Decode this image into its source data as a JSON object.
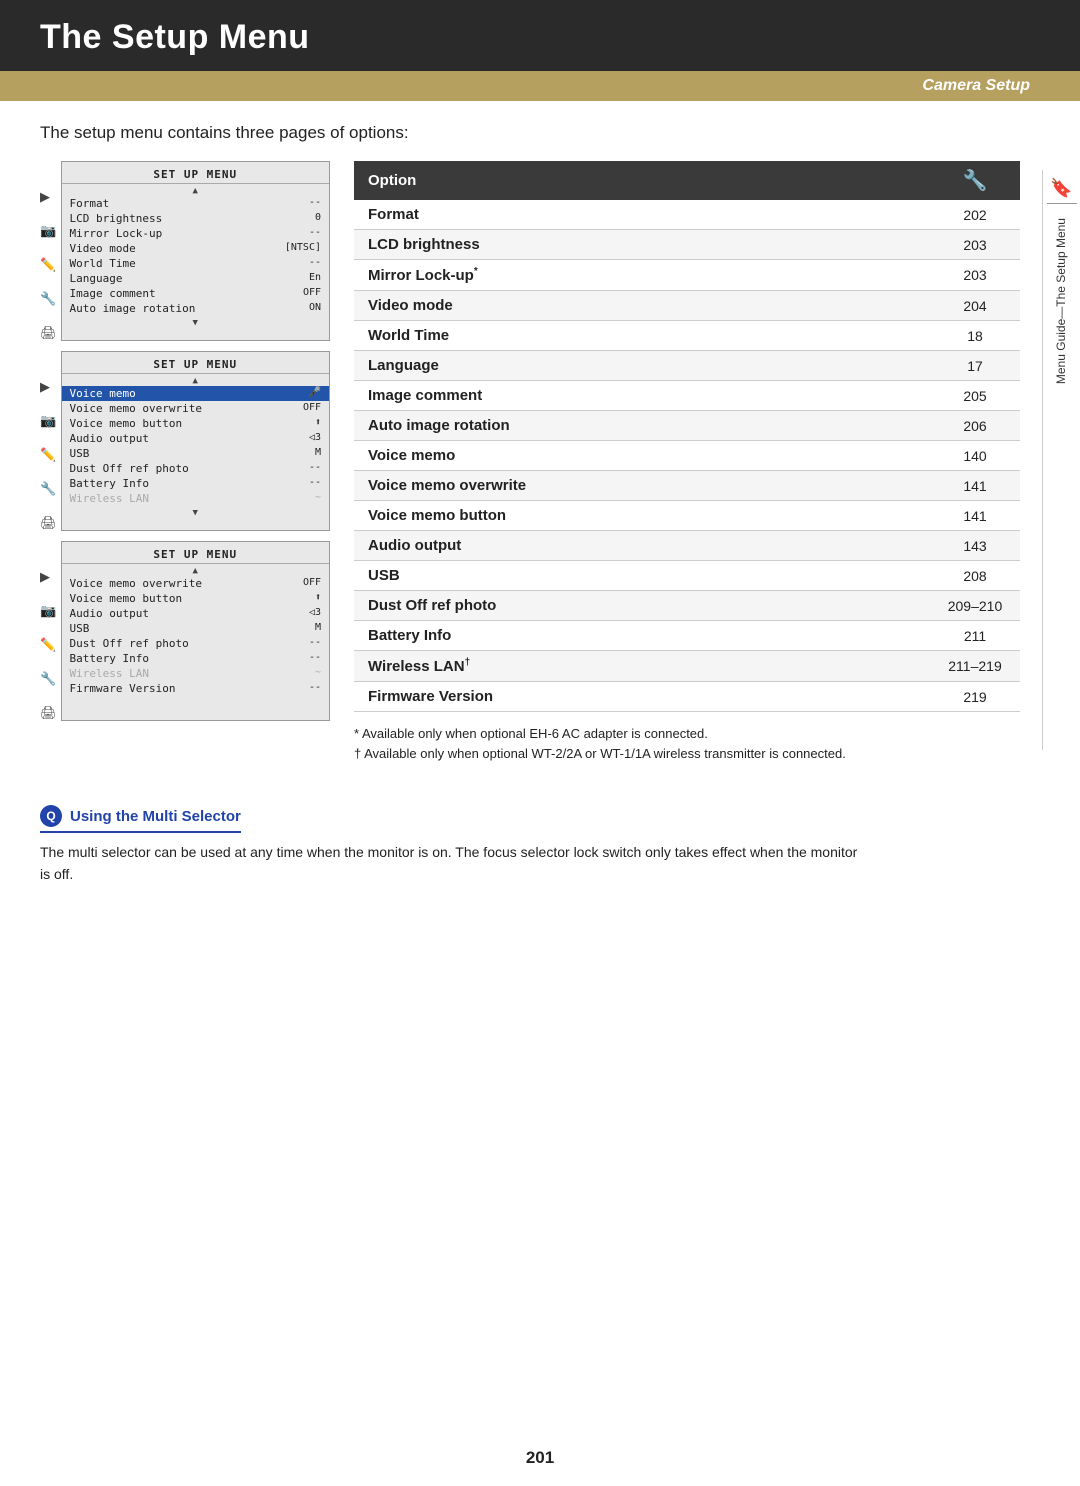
{
  "header": {
    "title": "The Setup Menu",
    "subtitle": "Camera Setup"
  },
  "intro": "The setup menu contains three pages of options:",
  "menus": [
    {
      "id": "menu1",
      "items": [
        {
          "label": "Format",
          "value": "--",
          "highlighted": false
        },
        {
          "label": "LCD brightness",
          "value": "0",
          "highlighted": false
        },
        {
          "label": "Mirror Lock-up",
          "value": "--",
          "highlighted": false
        },
        {
          "label": "Video mode",
          "value": "NTSC",
          "highlighted": false
        },
        {
          "label": "World Time",
          "value": "--",
          "highlighted": false
        },
        {
          "label": "Language",
          "value": "En",
          "highlighted": false
        },
        {
          "label": "Image comment",
          "value": "OFF",
          "highlighted": false
        },
        {
          "label": "Auto image rotation",
          "value": "ON",
          "highlighted": false
        }
      ]
    },
    {
      "id": "menu2",
      "items": [
        {
          "label": "Voice memo",
          "value": "🎤",
          "highlighted": true
        },
        {
          "label": "Voice memo overwrite",
          "value": "OFF",
          "highlighted": false
        },
        {
          "label": "Voice memo button",
          "value": "↑↓",
          "highlighted": false
        },
        {
          "label": "Audio output",
          "value": "◁3",
          "highlighted": false
        },
        {
          "label": "USB",
          "value": "M",
          "highlighted": false
        },
        {
          "label": "Dust Off ref photo",
          "value": "--",
          "highlighted": false
        },
        {
          "label": "Battery Info",
          "value": "--",
          "highlighted": false
        },
        {
          "label": "Wireless LAN",
          "value": "~",
          "highlighted": false,
          "greyed": true
        }
      ]
    },
    {
      "id": "menu3",
      "items": [
        {
          "label": "Voice memo overwrite",
          "value": "OFF",
          "highlighted": false
        },
        {
          "label": "Voice memo button",
          "value": "↑↓",
          "highlighted": false
        },
        {
          "label": "Audio output",
          "value": "◁3",
          "highlighted": false
        },
        {
          "label": "USB",
          "value": "M",
          "highlighted": false
        },
        {
          "label": "Dust Off ref photo",
          "value": "--",
          "highlighted": false
        },
        {
          "label": "Battery Info",
          "value": "--",
          "highlighted": false
        },
        {
          "label": "Wireless LAN",
          "value": "~",
          "highlighted": false,
          "greyed": true
        },
        {
          "label": "Firmware Version",
          "value": "--",
          "highlighted": false
        }
      ]
    }
  ],
  "table": {
    "col1": "Option",
    "col2": "🔧",
    "rows": [
      {
        "option": "Format",
        "page": "202"
      },
      {
        "option": "LCD brightness",
        "page": "203"
      },
      {
        "option": "Mirror Lock-up*",
        "page": "203",
        "asterisk": true
      },
      {
        "option": "Video mode",
        "page": "204"
      },
      {
        "option": "World Time",
        "page": "18"
      },
      {
        "option": "Language",
        "page": "17"
      },
      {
        "option": "Image comment",
        "page": "205"
      },
      {
        "option": "Auto image rotation",
        "page": "206"
      },
      {
        "option": "Voice memo",
        "page": "140"
      },
      {
        "option": "Voice memo overwrite",
        "page": "141"
      },
      {
        "option": "Voice memo button",
        "page": "141"
      },
      {
        "option": "Audio output",
        "page": "143"
      },
      {
        "option": "USB",
        "page": "208"
      },
      {
        "option": "Dust Off ref photo",
        "page": "209–210"
      },
      {
        "option": "Battery Info",
        "page": "211"
      },
      {
        "option": "Wireless LAN†",
        "page": "211–219",
        "dagger": true
      },
      {
        "option": "Firmware Version",
        "page": "219"
      }
    ]
  },
  "footnotes": [
    "* Available only when optional EH-6 AC adapter is connected.",
    "† Available only when optional WT-2/2A or WT-1/1A wireless transmitter is connected."
  ],
  "multi_selector": {
    "heading": "Using the Multi Selector",
    "text": "The multi selector can be used at any time when the monitor is on.  The focus selector lock switch only takes effect when the monitor is off."
  },
  "page_number": "201",
  "sidebar_text": "Menu Guide—The Setup Menu"
}
